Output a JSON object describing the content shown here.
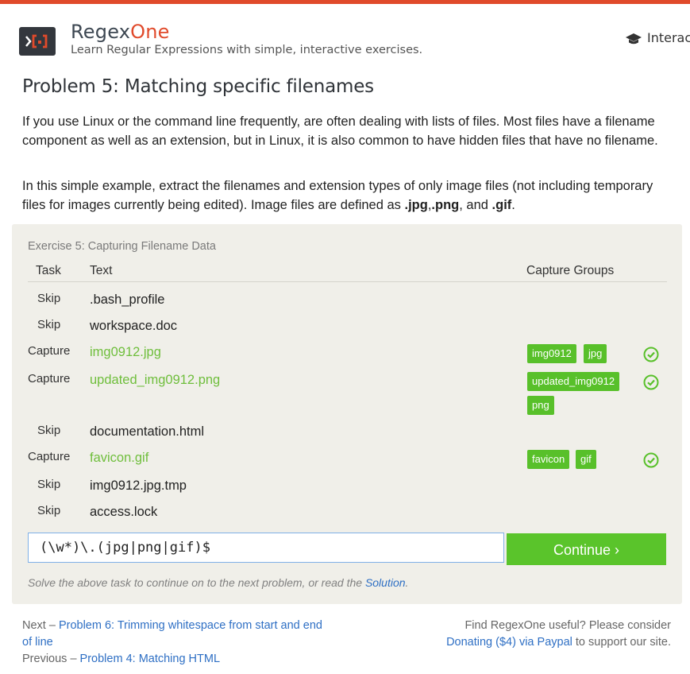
{
  "brand": {
    "name_part1": "Regex",
    "name_part2": "One",
    "tagline": "Learn Regular Expressions with simple, interactive exercises.",
    "accent": "#e04a2b"
  },
  "nav": {
    "interactive_label": "Interactive"
  },
  "problem": {
    "title": "Problem 5: Matching specific filenames",
    "p1": "If you use Linux or the command line frequently, are often dealing with lists of files. Most files have a filename component as well as an extension, but in Linux, it is also common to have hidden files that have no filename.",
    "p2_text": "In this simple example, extract the filenames and extension types of only image files (not including temporary files for images currently being edited). Image files are defined as ",
    "p2_b1": ".jpg",
    "p2_sep1": ",",
    "p2_b2": ".png",
    "p2_sep2": ", and ",
    "p2_b3": ".gif",
    "p2_end": "."
  },
  "exercise": {
    "title": "Exercise 5: Capturing Filename Data",
    "headers": {
      "task": "Task",
      "text": "Text",
      "groups": "Capture Groups"
    },
    "rows": [
      {
        "task": "Skip",
        "text": ".bash_profile"
      },
      {
        "task": "Skip",
        "text": "workspace.doc"
      },
      {
        "task": "Capture",
        "text": "img0912.jpg",
        "groups": [
          "img0912",
          "jpg"
        ]
      },
      {
        "task": "Capture",
        "text": "updated_img0912.png",
        "groups": [
          "updated_img0912",
          "png"
        ]
      },
      {
        "task": "Skip",
        "text": "documentation.html"
      },
      {
        "task": "Capture",
        "text": "favicon.gif",
        "groups": [
          "favicon",
          "gif"
        ]
      },
      {
        "task": "Skip",
        "text": "img0912.jpg.tmp"
      },
      {
        "task": "Skip",
        "text": "access.lock"
      }
    ],
    "input_value": "(\\w*)\\.(jpg|png|gif)$",
    "continue_label": "Continue ›",
    "hint_text": "Solve the above task to continue on to the next problem, or read the ",
    "hint_link": "Solution",
    "hint_end": "."
  },
  "footer": {
    "next_prefix": "Next – ",
    "next_link": "Problem 6: Trimming whitespace from start and end of line",
    "prev_prefix": "Previous – ",
    "prev_link": "Problem 4: Matching HTML",
    "support_text": "Find RegexOne useful? Please consider ",
    "donate_link": "Donating ($4) via Paypal",
    "support_end": " to support our site."
  }
}
